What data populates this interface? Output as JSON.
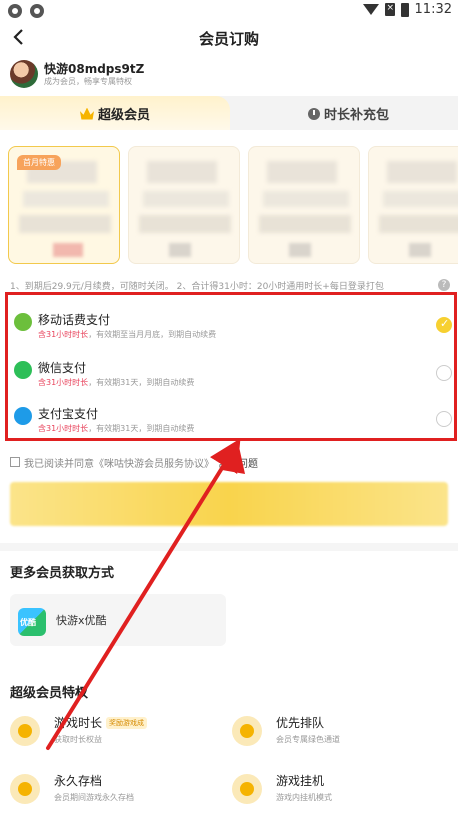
{
  "status_bar": {
    "time": "11:32"
  },
  "header": {
    "title": "会员订购"
  },
  "user": {
    "name": "快游08mdps9tZ",
    "subtitle": "成为会员，畅享专属特权"
  },
  "tabs": [
    {
      "label": "超级会员",
      "icon": "crown-icon"
    },
    {
      "label": "时长补充包",
      "icon": "clock-icon"
    }
  ],
  "packages": {
    "badge": "首月特惠"
  },
  "terms_line": "1、到期后29.9元/月续费，可随时关闭。 2、合计得31小时：20小时通用时长+每日登录打包",
  "payment_methods": [
    {
      "name": "移动话费支付",
      "highlight": "含31小时时长",
      "desc": "，有效期至当月月底，到期自动续费",
      "icon": "mobile-pay-icon",
      "checked": true
    },
    {
      "name": "微信支付",
      "highlight": "含31小时时长",
      "desc": "，有效期31天，到期自动续费",
      "icon": "wechat-icon",
      "checked": false
    },
    {
      "name": "支付宝支付",
      "highlight": "含31小时时长",
      "desc": "，有效期31天，到期自动续费",
      "icon": "alipay-icon",
      "checked": false
    }
  ],
  "agreement": {
    "text": "我已阅读并同意《咪咕快游会员服务协议》",
    "faq": "常见问题"
  },
  "more_ways": {
    "title": "更多会员获取方式",
    "item_label": "快游x优酷",
    "item_icon_text": "优酷"
  },
  "features": {
    "title": "超级会员特权",
    "items": [
      {
        "title": "游戏时长",
        "tag": "奖励游戏成",
        "desc": "获取时长权益"
      },
      {
        "title": "优先排队",
        "desc": "会员专属绿色通道"
      },
      {
        "title": "永久存档",
        "desc": "会员期间游戏永久存档"
      },
      {
        "title": "游戏挂机",
        "desc": "游戏内挂机模式"
      }
    ]
  },
  "colors": {
    "accent": "#f7d031",
    "highlight_red": "#e02020",
    "price_pink": "#e8425b"
  }
}
